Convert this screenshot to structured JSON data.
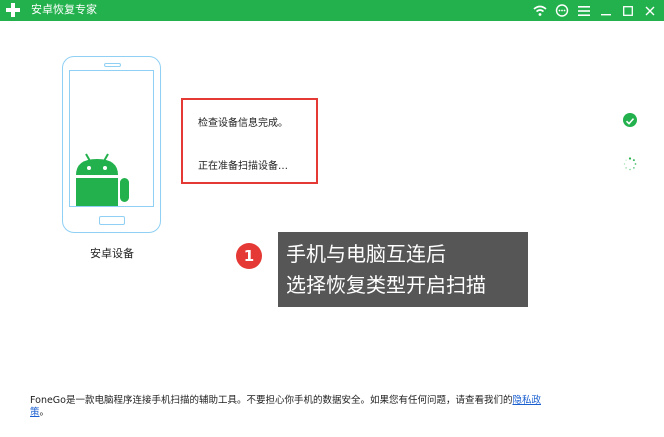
{
  "window": {
    "title": "安卓恢复专家",
    "icons": [
      "wifi-icon",
      "chat-icon",
      "menu-icon",
      "minimize-icon",
      "maximize-icon",
      "close-icon"
    ]
  },
  "device": {
    "label": "安卓设备"
  },
  "status": {
    "lines": [
      "检查设备信息完成。",
      "正在准备扫描设备…"
    ]
  },
  "callout": {
    "step": "1",
    "lines": [
      "手机与电脑互连后",
      "选择恢复类型开启扫描"
    ]
  },
  "footer": {
    "text": "FoneGo是一款电脑程序连接手机扫描的辅助工具。不要担心你手机的数据安全。如果您有任何问题，请查看我们的",
    "link_part1": "隐私政",
    "link_part2": "策",
    "tail": "。"
  },
  "colors": {
    "brand_green": "#23b14d",
    "highlight_red": "#e53935",
    "phone_outline": "#8fd0f4",
    "callout_bg": "#565656",
    "link_blue": "#1a5fd0"
  }
}
